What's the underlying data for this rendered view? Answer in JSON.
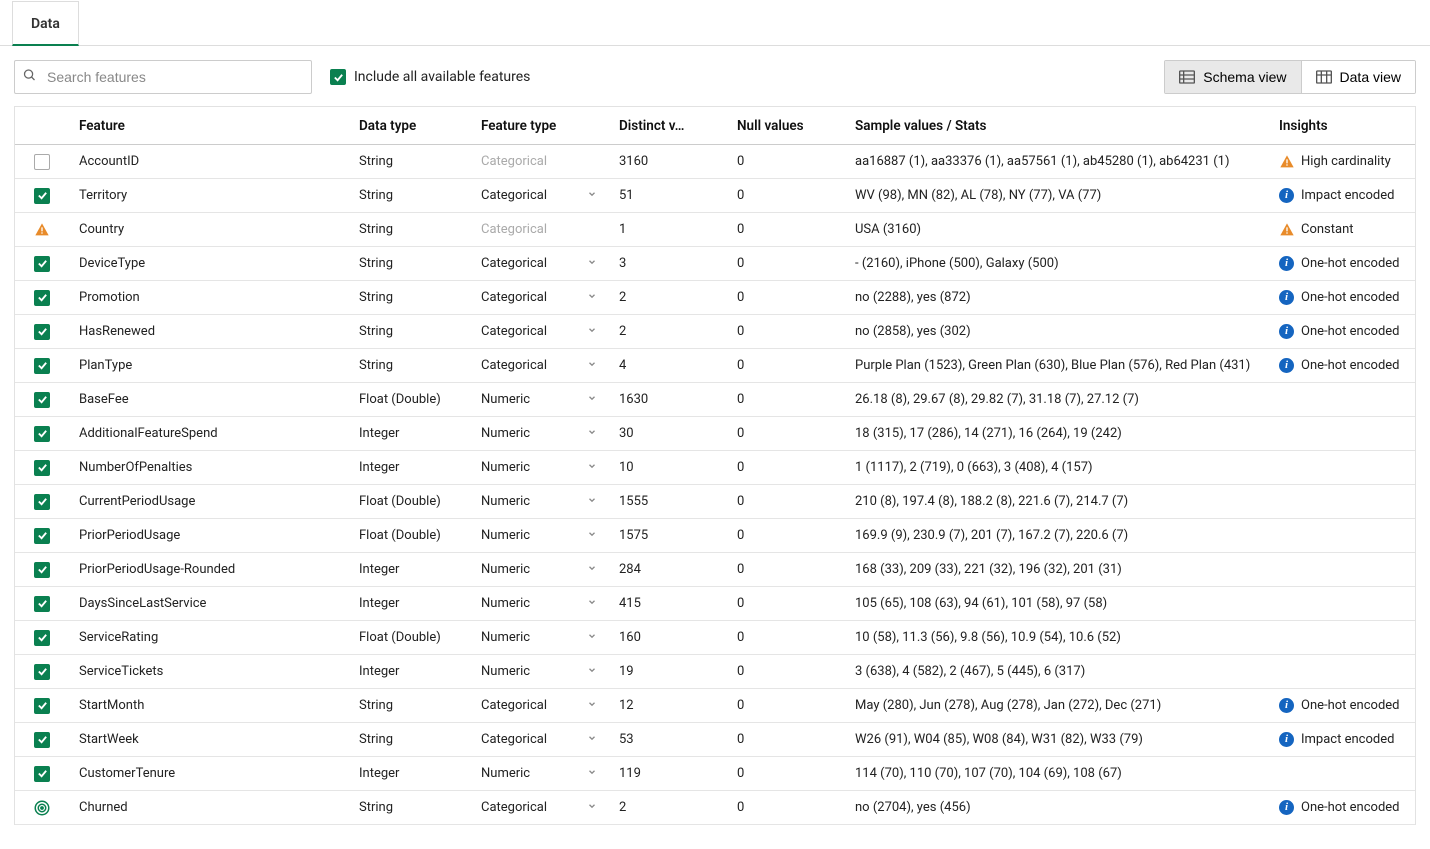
{
  "tab": {
    "label": "Data"
  },
  "search": {
    "placeholder": "Search features"
  },
  "include_label": "Include all available features",
  "views": {
    "schema": "Schema view",
    "data": "Data view"
  },
  "columns": {
    "feature": "Feature",
    "data_type": "Data type",
    "feature_type": "Feature type",
    "distinct": "Distinct v…",
    "nulls": "Null values",
    "sample": "Sample values / Stats",
    "insights": "Insights"
  },
  "insights_icons": {
    "warn": "warning-icon",
    "info": "info-icon"
  },
  "rows": [
    {
      "checked": "empty",
      "feature": "AccountID",
      "data_type": "String",
      "feature_type": "Categorical",
      "feature_type_disabled": true,
      "distinct": "3160",
      "nulls": "0",
      "sample": "aa16887 (1), aa33376 (1), aa57561 (1), ab45280 (1), ab64231 (1)",
      "insight": "High cardinality",
      "insight_kind": "warn"
    },
    {
      "checked": "on",
      "feature": "Territory",
      "data_type": "String",
      "feature_type": "Categorical",
      "distinct": "51",
      "nulls": "0",
      "sample": "WV (98), MN (82), AL (78), NY (77), VA (77)",
      "insight": "Impact encoded",
      "insight_kind": "info"
    },
    {
      "checked": "warn",
      "feature": "Country",
      "data_type": "String",
      "feature_type": "Categorical",
      "feature_type_disabled": true,
      "distinct": "1",
      "nulls": "0",
      "sample": "USA (3160)",
      "insight": "Constant",
      "insight_kind": "warn"
    },
    {
      "checked": "on",
      "feature": "DeviceType",
      "data_type": "String",
      "feature_type": "Categorical",
      "distinct": "3",
      "nulls": "0",
      "sample": "- (2160), iPhone (500), Galaxy (500)",
      "insight": "One-hot encoded",
      "insight_kind": "info"
    },
    {
      "checked": "on",
      "feature": "Promotion",
      "data_type": "String",
      "feature_type": "Categorical",
      "distinct": "2",
      "nulls": "0",
      "sample": "no (2288), yes (872)",
      "insight": "One-hot encoded",
      "insight_kind": "info"
    },
    {
      "checked": "on",
      "feature": "HasRenewed",
      "data_type": "String",
      "feature_type": "Categorical",
      "distinct": "2",
      "nulls": "0",
      "sample": "no (2858), yes (302)",
      "insight": "One-hot encoded",
      "insight_kind": "info"
    },
    {
      "checked": "on",
      "feature": "PlanType",
      "data_type": "String",
      "feature_type": "Categorical",
      "distinct": "4",
      "nulls": "0",
      "sample": "Purple Plan (1523), Green Plan (630), Blue Plan (576), Red Plan (431)",
      "insight": "One-hot encoded",
      "insight_kind": "info"
    },
    {
      "checked": "on",
      "feature": "BaseFee",
      "data_type": "Float (Double)",
      "feature_type": "Numeric",
      "distinct": "1630",
      "nulls": "0",
      "sample": "26.18 (8), 29.67 (8), 29.82 (7), 31.18 (7), 27.12 (7)"
    },
    {
      "checked": "on",
      "feature": "AdditionalFeatureSpend",
      "data_type": "Integer",
      "feature_type": "Numeric",
      "distinct": "30",
      "nulls": "0",
      "sample": "18 (315), 17 (286), 14 (271), 16 (264), 19 (242)"
    },
    {
      "checked": "on",
      "feature": "NumberOfPenalties",
      "data_type": "Integer",
      "feature_type": "Numeric",
      "distinct": "10",
      "nulls": "0",
      "sample": "1 (1117), 2 (719), 0 (663), 3 (408), 4 (157)"
    },
    {
      "checked": "on",
      "feature": "CurrentPeriodUsage",
      "data_type": "Float (Double)",
      "feature_type": "Numeric",
      "distinct": "1555",
      "nulls": "0",
      "sample": "210 (8), 197.4 (8), 188.2 (8), 221.6 (7), 214.7 (7)"
    },
    {
      "checked": "on",
      "feature": "PriorPeriodUsage",
      "data_type": "Float (Double)",
      "feature_type": "Numeric",
      "distinct": "1575",
      "nulls": "0",
      "sample": "169.9 (9), 230.9 (7), 201 (7), 167.2 (7), 220.6 (7)"
    },
    {
      "checked": "on",
      "feature": "PriorPeriodUsage-Rounded",
      "data_type": "Integer",
      "feature_type": "Numeric",
      "distinct": "284",
      "nulls": "0",
      "sample": "168 (33), 209 (33), 221 (32), 196 (32), 201 (31)"
    },
    {
      "checked": "on",
      "feature": "DaysSinceLastService",
      "data_type": "Integer",
      "feature_type": "Numeric",
      "distinct": "415",
      "nulls": "0",
      "sample": "105 (65), 108 (63), 94 (61), 101 (58), 97 (58)"
    },
    {
      "checked": "on",
      "feature": "ServiceRating",
      "data_type": "Float (Double)",
      "feature_type": "Numeric",
      "distinct": "160",
      "nulls": "0",
      "sample": "10 (58), 11.3 (56), 9.8 (56), 10.9 (54), 10.6 (52)"
    },
    {
      "checked": "on",
      "feature": "ServiceTickets",
      "data_type": "Integer",
      "feature_type": "Numeric",
      "distinct": "19",
      "nulls": "0",
      "sample": "3 (638), 4 (582), 2 (467), 5 (445), 6 (317)"
    },
    {
      "checked": "on",
      "feature": "StartMonth",
      "data_type": "String",
      "feature_type": "Categorical",
      "distinct": "12",
      "nulls": "0",
      "sample": "May (280), Jun (278), Aug (278), Jan (272), Dec (271)",
      "insight": "One-hot encoded",
      "insight_kind": "info"
    },
    {
      "checked": "on",
      "feature": "StartWeek",
      "data_type": "String",
      "feature_type": "Categorical",
      "distinct": "53",
      "nulls": "0",
      "sample": "W26 (91), W04 (85), W08 (84), W31 (82), W33 (79)",
      "insight": "Impact encoded",
      "insight_kind": "info"
    },
    {
      "checked": "on",
      "feature": "CustomerTenure",
      "data_type": "Integer",
      "feature_type": "Numeric",
      "distinct": "119",
      "nulls": "0",
      "sample": "114 (70), 110 (70), 107 (70), 104 (69), 108 (67)"
    },
    {
      "checked": "target",
      "feature": "Churned",
      "data_type": "String",
      "feature_type": "Categorical",
      "distinct": "2",
      "nulls": "0",
      "sample": "no (2704), yes (456)",
      "insight": "One-hot encoded",
      "insight_kind": "info"
    }
  ]
}
